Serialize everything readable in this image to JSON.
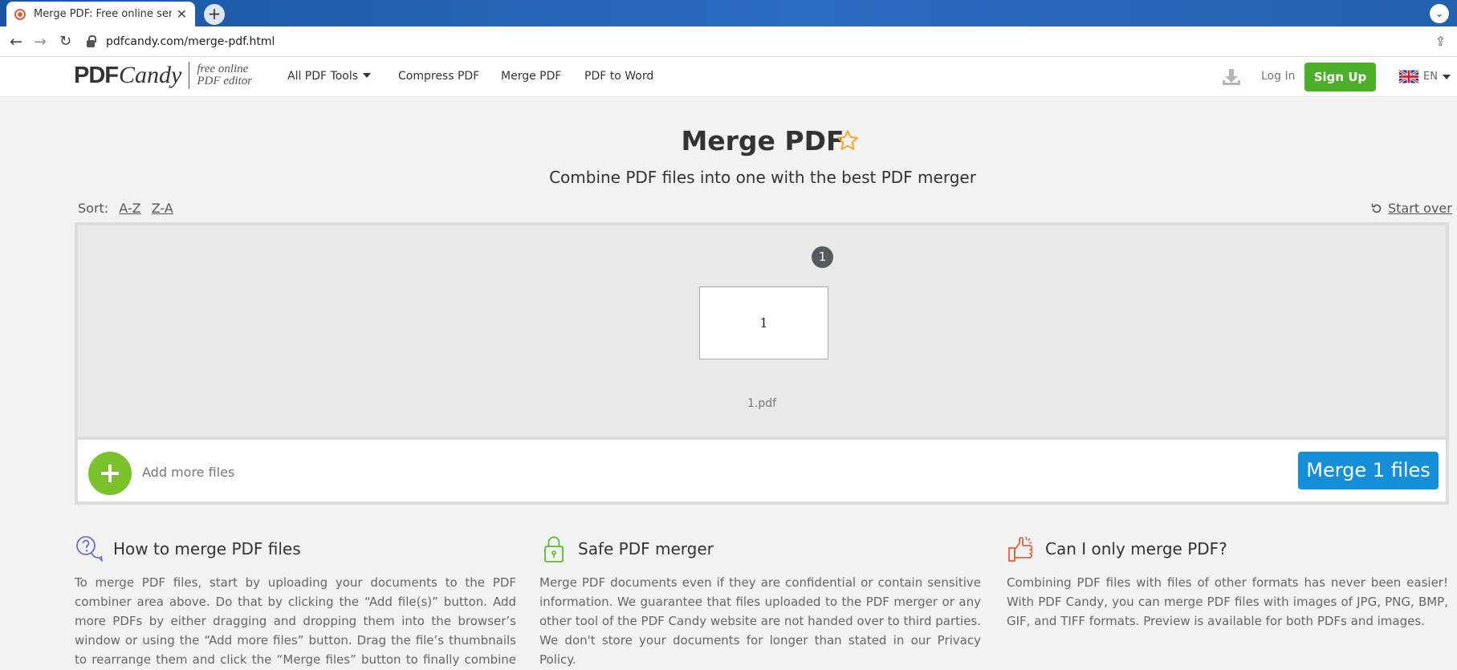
{
  "browser": {
    "tab_title": "Merge PDF: Free online service",
    "new_tab": "+",
    "url": "pdfcandy.com/merge-pdf.html"
  },
  "header": {
    "logo_pdf": "PDF",
    "logo_candy": "Candy",
    "logo_tagline_1": "free online",
    "logo_tagline_2": "PDF editor",
    "menu": [
      "All PDF Tools",
      "Compress PDF",
      "Merge PDF",
      "PDF to Word"
    ],
    "login": "Log In",
    "signup": "Sign Up",
    "lang": "EN"
  },
  "main": {
    "title": "Merge PDF",
    "subtitle": "Combine PDF files into one with the best PDF merger",
    "sort_label": "Sort:",
    "sort_az": "A-Z",
    "sort_za": "Z-A",
    "start_over": "Start over",
    "page_badge": "1",
    "thumb_text": "1",
    "file_name": "1.pdf",
    "add_more": "Add more files",
    "merge_button": "Merge 1 files"
  },
  "info": [
    {
      "title": "How to merge PDF files",
      "text": "To merge PDF files, start by uploading your documents to the PDF combiner area above. Do that by clicking the “Add file(s)” button. Add more PDFs by either dragging and dropping them into the browser’s window or using the “Add more files” button. Drag the file’s thumbnails to rearrange them and click the “Merge files” button to finally combine PDFs into one."
    },
    {
      "title": "Safe PDF merger",
      "text": "Merge PDF documents even if they are confidential or contain sensitive information. We guarantee that files uploaded to the PDF merger or any other tool of the PDF Candy website are not handed over to third parties. We don't store your documents for longer than stated in our Privacy Policy."
    },
    {
      "title": "Can I only merge PDF?",
      "text": "Combining PDF files with files of other formats has never been easier! With PDF Candy, you can merge PDF files with images of JPG, PNG, BMP, GIF, and TIFF formats. Preview is available for both PDFs and images."
    }
  ],
  "colors": {
    "signup_green": "#4caf2a",
    "merge_blue": "#168fd9",
    "add_green": "#7ac12c",
    "star_gold": "#f4a823"
  }
}
